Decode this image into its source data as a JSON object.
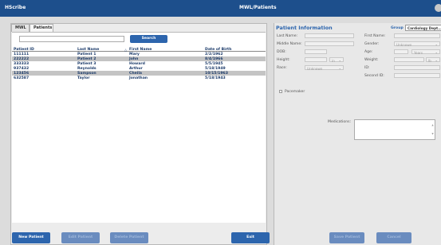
{
  "app": {
    "name": "HScribe"
  },
  "window": {
    "title": "MWL/Patients"
  },
  "tabs": [
    {
      "label": "MWL"
    },
    {
      "label": "Patients"
    }
  ],
  "search": {
    "placeholder": "",
    "button_label": "Search"
  },
  "table": {
    "headers": [
      "Patient ID",
      "Last Name",
      "First Name",
      "Date of Birth"
    ],
    "rows": [
      [
        "111111",
        "Patient 1",
        "Mary",
        "2/2/1962"
      ],
      [
        "222222",
        "Patient 2",
        "John",
        "8/4/1966"
      ],
      [
        "333333",
        "Patient 3",
        "Howard",
        "5/5/1945"
      ],
      [
        "937432",
        "Reynolds",
        "Arthur",
        "5/18/1949"
      ],
      [
        "123456",
        "Sampson",
        "Cheila",
        "10/15/1963"
      ],
      [
        "632587",
        "Taylor",
        "Jonathan",
        "5/18/1943"
      ]
    ]
  },
  "footer_left": {
    "new_patient": "New Patient",
    "edit_patient": "Edit Patient",
    "delete_patient": "Delete Patient",
    "exit": "Exit"
  },
  "footer_right": {
    "save_patient": "Save Patient",
    "cancel": "Cancel"
  },
  "patient_info": {
    "title": "Patient Information",
    "group_label": "Group",
    "group_value": "Cardiology Dept...",
    "labels": {
      "last_name": "Last Name:",
      "first_name": "First Name:",
      "middle_name": "Middle Name:",
      "gender": "Gender:",
      "dob": "DOB:",
      "age": "Age:",
      "height": "Height:",
      "weight": "Weight:",
      "race": "Race:",
      "id": "ID:",
      "second_id": "Second ID:",
      "pacemaker": "Pacemaker",
      "medications": "Medications:"
    },
    "gender_value": "Unknown",
    "age_unit": "Years",
    "height_unit": "in",
    "weight_unit": "lb",
    "race_value": "Unknown"
  },
  "colors": {
    "titlebar": "#1d4f8c",
    "button": "#2d65ad",
    "selected_row": "#c4c4c4"
  }
}
